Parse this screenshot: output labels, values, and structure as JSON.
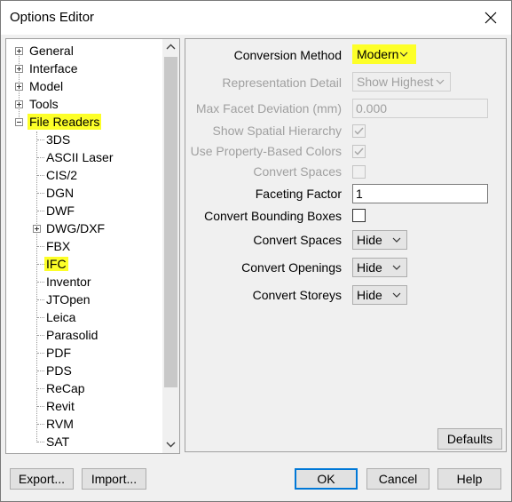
{
  "window": {
    "title": "Options Editor"
  },
  "tree": {
    "top_items": [
      "General",
      "Interface",
      "Model",
      "Tools"
    ],
    "selected_group": "File Readers",
    "readers": [
      "3DS",
      "ASCII Laser",
      "CIS/2",
      "DGN",
      "DWF",
      "DWG/DXF",
      "FBX",
      "IFC",
      "Inventor",
      "JTOpen",
      "Leica",
      "Parasolid",
      "PDF",
      "PDS",
      "ReCap",
      "Revit",
      "RVM",
      "SAT"
    ],
    "highlighted_reader": "IFC"
  },
  "settings": {
    "conversion_method": {
      "label": "Conversion Method",
      "value": "Modern"
    },
    "representation_detail": {
      "label": "Representation Detail",
      "value": "Show Highest"
    },
    "max_facet_deviation": {
      "label": "Max Facet Deviation (mm)",
      "value": "0.000"
    },
    "show_spatial_hierarchy": {
      "label": "Show Spatial Hierarchy",
      "checked": true
    },
    "use_property_colors": {
      "label": "Use Property-Based Colors",
      "checked": true
    },
    "convert_spaces_disabled": {
      "label": "Convert Spaces",
      "checked": false
    },
    "faceting_factor": {
      "label": "Faceting Factor",
      "value": "1"
    },
    "convert_bounding_boxes": {
      "label": "Convert Bounding Boxes",
      "checked": false
    },
    "convert_spaces": {
      "label": "Convert Spaces",
      "value": "Hide"
    },
    "convert_openings": {
      "label": "Convert Openings",
      "value": "Hide"
    },
    "convert_storeys": {
      "label": "Convert Storeys",
      "value": "Hide"
    }
  },
  "buttons": {
    "defaults": "Defaults",
    "export": "Export...",
    "import": "Import...",
    "ok": "OK",
    "cancel": "Cancel",
    "help": "Help"
  },
  "colors": {
    "highlight": "#fdff28",
    "default_button_border": "#0078d7"
  }
}
